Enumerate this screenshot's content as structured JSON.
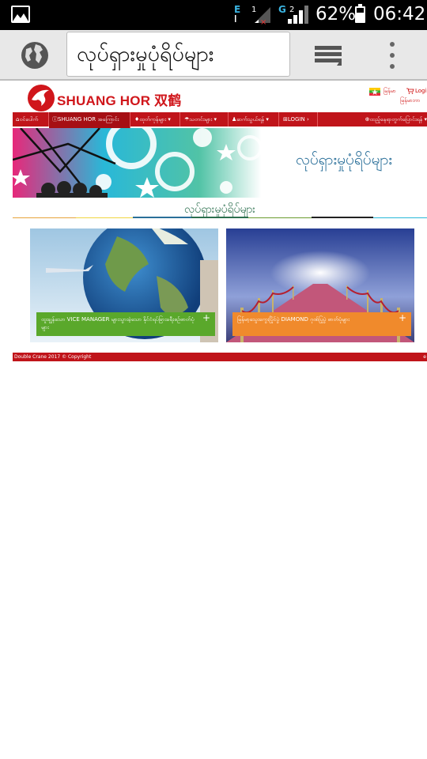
{
  "status_bar": {
    "network1_label": "E",
    "sim1_label": "1",
    "network2_label": "G",
    "sim2_label": "2",
    "battery_percent": "62%",
    "battery_level": 0.62,
    "time": "06:42"
  },
  "browser": {
    "url_text": "လုပ်ရှားမှုပုံရိပ်များ",
    "icons": [
      "globe-icon",
      "tabs-icon",
      "overflow-menu-icon"
    ]
  },
  "site": {
    "logo_text": "SHUANG HOR 双鹤",
    "top_links": {
      "language": "မြန်မာ",
      "login": "Login",
      "sub_language": "မြန်မာဘာ"
    },
    "nav": [
      {
        "label": "ဝင်ပေါက်"
      },
      {
        "label": "SHUANG HOR အကြောင်း"
      },
      {
        "label": "ထုတ်ကုန်များ"
      },
      {
        "label": "သတင်းများ"
      },
      {
        "label": "ဆက်သွယ်ရန်"
      },
      {
        "label": "LOGIN"
      }
    ],
    "nav_right": "ထည့်နေရာတွက်ပြောင်းရန်",
    "banner_title": "လုပ်ရှားမှုပုံရိပ်များ",
    "section_title": "လုပ်ရှားမှုပုံရိပ်များ",
    "cards": [
      {
        "caption": "ထူးချွန်သော VICE MANAGER များသွားခဲ့သော နိုင်ငံရပ်ခြားခရီးစဉ်ဓာတ်ပုံများ",
        "plus": "+"
      },
      {
        "caption": "မြန်မာ့သွေးကွေးပြိုင်ပွဲ DIAMOND ဂုဏ်ပြုပွဲ ဓာတ်ပုံများ",
        "plus": "+"
      }
    ],
    "footer": "Double Crane 2017 © Copyright",
    "footer_right": "e"
  },
  "colors": {
    "brand_red": "#c0141a",
    "caption_green": "#5aa82b",
    "caption_orange": "#f08a2c",
    "banner_text": "#2a6f99",
    "section_title": "#2b6f4e"
  }
}
